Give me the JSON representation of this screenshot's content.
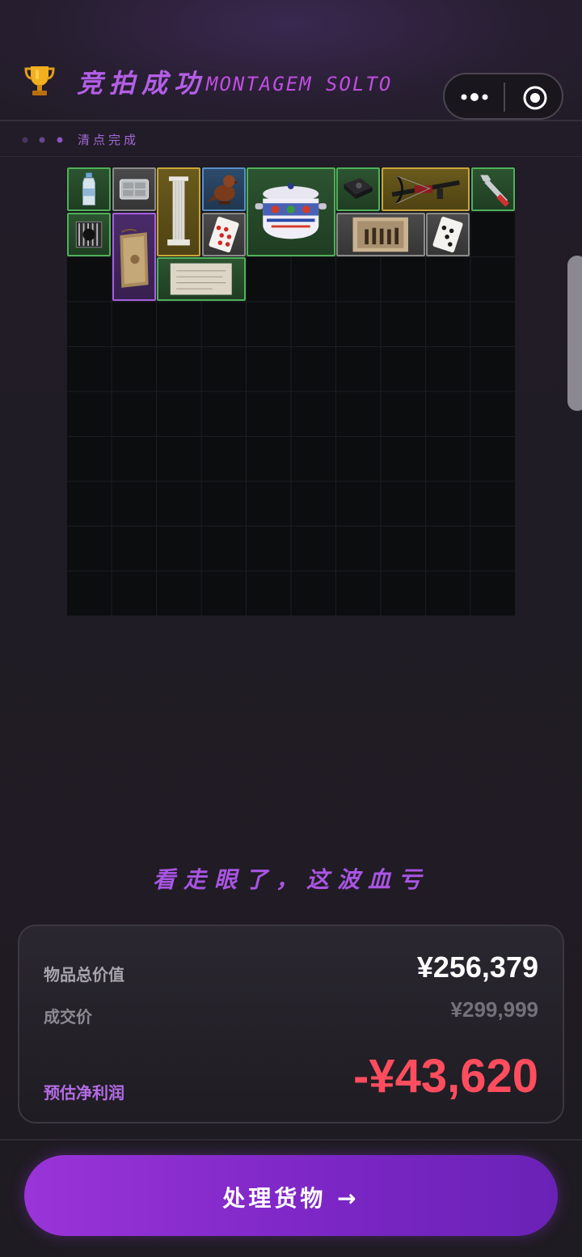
{
  "header": {
    "title": "竞拍成功",
    "subtitle": "MONTAGEM SOLTO",
    "trophy_icon": "trophy-icon",
    "status": "清点完成"
  },
  "capsule": {
    "more_icon": "more-dots-icon",
    "close_icon": "target-close-icon"
  },
  "inventory": {
    "columns": 10,
    "rows": 10,
    "items": [
      {
        "name": "water-bottle",
        "rarity": "green"
      },
      {
        "name": "plastic-tray",
        "rarity": "gray"
      },
      {
        "name": "marble-column",
        "rarity": "gold"
      },
      {
        "name": "wooden-bird-figurine",
        "rarity": "blue"
      },
      {
        "name": "ceramic-pot",
        "rarity": "green"
      },
      {
        "name": "hard-drive",
        "rarity": "green"
      },
      {
        "name": "crossbow",
        "rarity": "gold"
      },
      {
        "name": "wrench",
        "rarity": "green"
      },
      {
        "name": "cpu-cooler",
        "rarity": "green"
      },
      {
        "name": "old-book",
        "rarity": "purple"
      },
      {
        "name": "playing-card-hearts",
        "rarity": "gray"
      },
      {
        "name": "old-photograph",
        "rarity": "gray"
      },
      {
        "name": "playing-card-clubs",
        "rarity": "gray"
      },
      {
        "name": "old-letter",
        "rarity": "green"
      }
    ]
  },
  "verdict": "看走眼了，这波血亏",
  "summary": {
    "total_label": "物品总价值",
    "total_value": "¥256,379",
    "deal_label": "成交价",
    "deal_value": "¥299,999",
    "profit_label": "预估净利润",
    "profit_value": "-¥43,620"
  },
  "cta": {
    "label": "处理货物 →"
  },
  "colors": {
    "accent": "#9a34d8",
    "profit_negative": "#ff4d5e",
    "rarity_green": "#4fb05a",
    "rarity_gold": "#c9a53a",
    "rarity_blue": "#5a8fc7",
    "rarity_purple": "#a660e0",
    "rarity_gray": "#8a8a8a"
  }
}
